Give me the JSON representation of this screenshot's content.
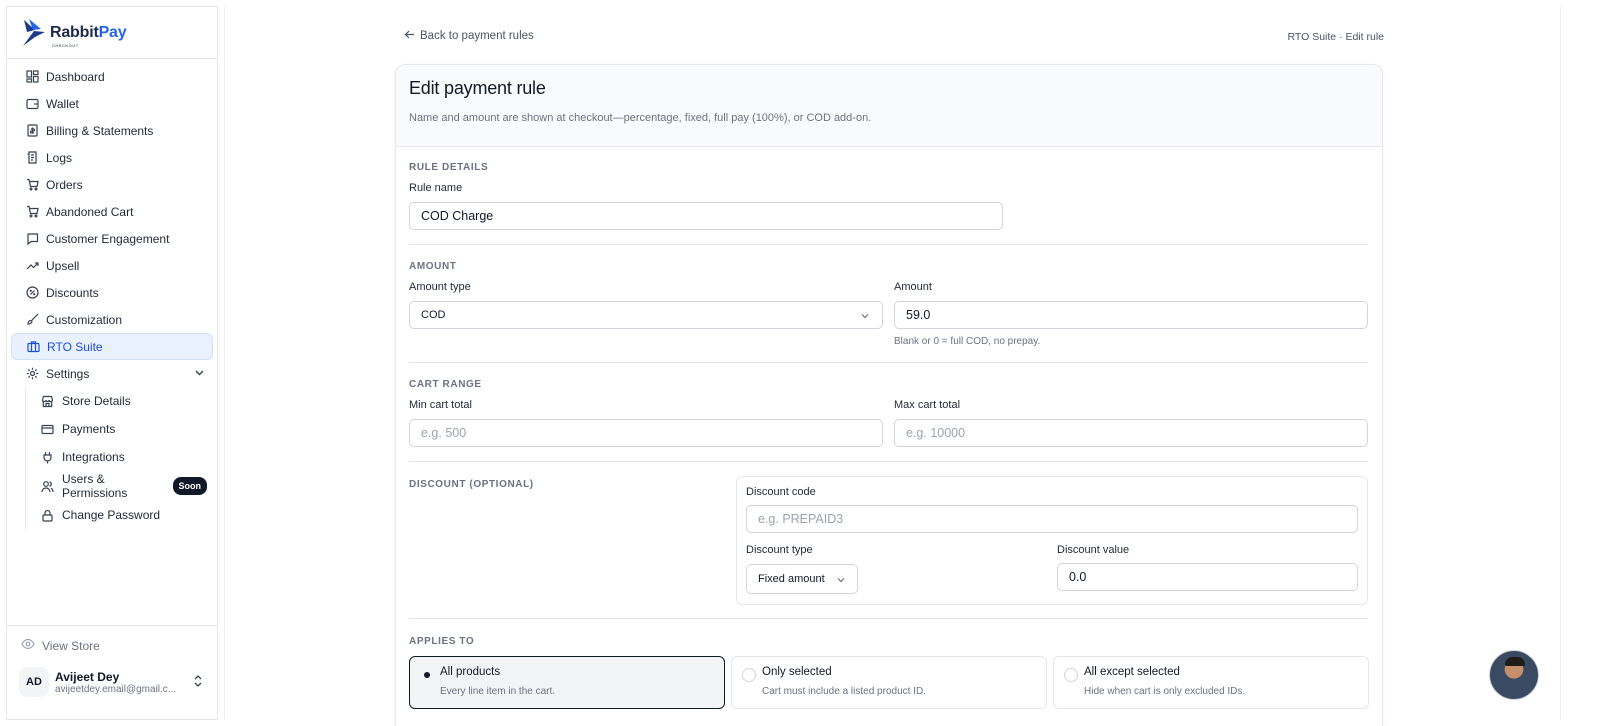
{
  "brand": {
    "name_part1": "Rabbit",
    "name_part2": "Pay",
    "tagline": "CHECKOUT"
  },
  "sidebar": {
    "items": [
      {
        "label": "Dashboard",
        "icon": "dashboard-icon"
      },
      {
        "label": "Wallet",
        "icon": "wallet-icon"
      },
      {
        "label": "Billing & Statements",
        "icon": "billing-icon"
      },
      {
        "label": "Logs",
        "icon": "logs-icon"
      },
      {
        "label": "Orders",
        "icon": "cart-icon"
      },
      {
        "label": "Abandoned Cart",
        "icon": "cart-icon"
      },
      {
        "label": "Customer Engagement",
        "icon": "chat-icon"
      },
      {
        "label": "Upsell",
        "icon": "trend-up-icon"
      },
      {
        "label": "Discounts",
        "icon": "discount-icon"
      },
      {
        "label": "Customization",
        "icon": "brush-icon"
      },
      {
        "label": "RTO Suite",
        "icon": "briefcase-icon",
        "active": true
      },
      {
        "label": "Settings",
        "icon": "gear-icon"
      }
    ],
    "settings_sub": [
      {
        "label": "Store Details",
        "icon": "store-icon"
      },
      {
        "label": "Payments",
        "icon": "card-icon"
      },
      {
        "label": "Integrations",
        "icon": "plug-icon"
      },
      {
        "label_line1": "Users &",
        "label_line2": "Permissions",
        "badge": "Soon",
        "icon": "users-icon"
      },
      {
        "label": "Change Password",
        "icon": "lock-icon"
      }
    ],
    "view_store": "View Store",
    "user": {
      "initials": "AD",
      "name": "Avijeet Dey",
      "email": "avijeetdey.email@gmail.c..."
    }
  },
  "topbar": {
    "back_label": "Back to payment rules",
    "breadcrumb": "RTO Suite · Edit rule"
  },
  "form": {
    "title": "Edit payment rule",
    "subtitle": "Name and amount are shown at checkout—percentage, fixed, full pay (100%), or COD add-on.",
    "rule_details": {
      "section": "RULE DETAILS",
      "name_label": "Rule name",
      "name_value": "COD Charge"
    },
    "amount": {
      "section": "AMOUNT",
      "type_label": "Amount type",
      "type_value": "COD",
      "amount_label": "Amount",
      "amount_value": "59.0",
      "hint": "Blank or 0 = full COD, no prepay."
    },
    "cart_range": {
      "section": "CART RANGE",
      "min_label": "Min cart total",
      "min_placeholder": "e.g. 500",
      "max_label": "Max cart total",
      "max_placeholder": "e.g. 10000"
    },
    "discount": {
      "section": "DISCOUNT (OPTIONAL)",
      "code_label": "Discount code",
      "code_placeholder": "e.g. PREPAID3",
      "type_label": "Discount type",
      "type_value": "Fixed amount",
      "value_label": "Discount value",
      "value_value": "0.0"
    },
    "applies_to": {
      "section": "APPLIES TO",
      "options": [
        {
          "title": "All products",
          "desc": "Every line item in the cart.",
          "selected": true
        },
        {
          "title": "Only selected",
          "desc": "Cart must include a listed product ID.",
          "selected": false
        },
        {
          "title": "All except selected",
          "desc": "Hide when cart is only excluded IDs.",
          "selected": false
        }
      ]
    }
  },
  "colors": {
    "accent": "#2563eb",
    "active_bg": "#e8f1fd",
    "badge_bg": "#111827"
  }
}
